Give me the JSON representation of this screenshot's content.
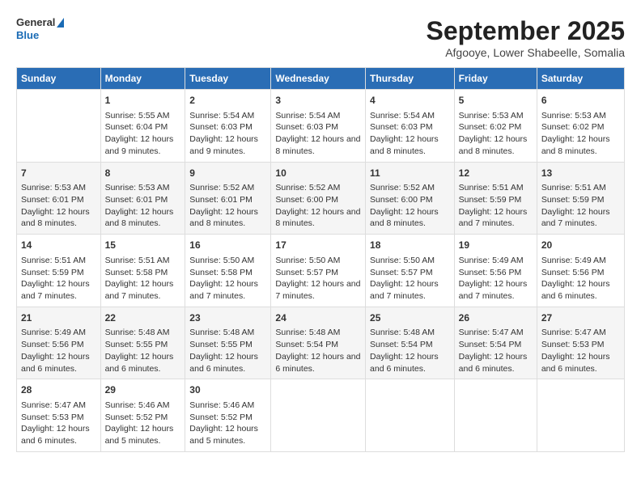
{
  "logo": {
    "line1": "General",
    "line2": "Blue"
  },
  "title": "September 2025",
  "subtitle": "Afgooye, Lower Shabeelle, Somalia",
  "days_of_week": [
    "Sunday",
    "Monday",
    "Tuesday",
    "Wednesday",
    "Thursday",
    "Friday",
    "Saturday"
  ],
  "weeks": [
    [
      {
        "day": "",
        "sunrise": "",
        "sunset": "",
        "daylight": ""
      },
      {
        "day": "1",
        "sunrise": "Sunrise: 5:55 AM",
        "sunset": "Sunset: 6:04 PM",
        "daylight": "Daylight: 12 hours and 9 minutes."
      },
      {
        "day": "2",
        "sunrise": "Sunrise: 5:54 AM",
        "sunset": "Sunset: 6:03 PM",
        "daylight": "Daylight: 12 hours and 9 minutes."
      },
      {
        "day": "3",
        "sunrise": "Sunrise: 5:54 AM",
        "sunset": "Sunset: 6:03 PM",
        "daylight": "Daylight: 12 hours and 8 minutes."
      },
      {
        "day": "4",
        "sunrise": "Sunrise: 5:54 AM",
        "sunset": "Sunset: 6:03 PM",
        "daylight": "Daylight: 12 hours and 8 minutes."
      },
      {
        "day": "5",
        "sunrise": "Sunrise: 5:53 AM",
        "sunset": "Sunset: 6:02 PM",
        "daylight": "Daylight: 12 hours and 8 minutes."
      },
      {
        "day": "6",
        "sunrise": "Sunrise: 5:53 AM",
        "sunset": "Sunset: 6:02 PM",
        "daylight": "Daylight: 12 hours and 8 minutes."
      }
    ],
    [
      {
        "day": "7",
        "sunrise": "Sunrise: 5:53 AM",
        "sunset": "Sunset: 6:01 PM",
        "daylight": "Daylight: 12 hours and 8 minutes."
      },
      {
        "day": "8",
        "sunrise": "Sunrise: 5:53 AM",
        "sunset": "Sunset: 6:01 PM",
        "daylight": "Daylight: 12 hours and 8 minutes."
      },
      {
        "day": "9",
        "sunrise": "Sunrise: 5:52 AM",
        "sunset": "Sunset: 6:01 PM",
        "daylight": "Daylight: 12 hours and 8 minutes."
      },
      {
        "day": "10",
        "sunrise": "Sunrise: 5:52 AM",
        "sunset": "Sunset: 6:00 PM",
        "daylight": "Daylight: 12 hours and 8 minutes."
      },
      {
        "day": "11",
        "sunrise": "Sunrise: 5:52 AM",
        "sunset": "Sunset: 6:00 PM",
        "daylight": "Daylight: 12 hours and 8 minutes."
      },
      {
        "day": "12",
        "sunrise": "Sunrise: 5:51 AM",
        "sunset": "Sunset: 5:59 PM",
        "daylight": "Daylight: 12 hours and 7 minutes."
      },
      {
        "day": "13",
        "sunrise": "Sunrise: 5:51 AM",
        "sunset": "Sunset: 5:59 PM",
        "daylight": "Daylight: 12 hours and 7 minutes."
      }
    ],
    [
      {
        "day": "14",
        "sunrise": "Sunrise: 5:51 AM",
        "sunset": "Sunset: 5:59 PM",
        "daylight": "Daylight: 12 hours and 7 minutes."
      },
      {
        "day": "15",
        "sunrise": "Sunrise: 5:51 AM",
        "sunset": "Sunset: 5:58 PM",
        "daylight": "Daylight: 12 hours and 7 minutes."
      },
      {
        "day": "16",
        "sunrise": "Sunrise: 5:50 AM",
        "sunset": "Sunset: 5:58 PM",
        "daylight": "Daylight: 12 hours and 7 minutes."
      },
      {
        "day": "17",
        "sunrise": "Sunrise: 5:50 AM",
        "sunset": "Sunset: 5:57 PM",
        "daylight": "Daylight: 12 hours and 7 minutes."
      },
      {
        "day": "18",
        "sunrise": "Sunrise: 5:50 AM",
        "sunset": "Sunset: 5:57 PM",
        "daylight": "Daylight: 12 hours and 7 minutes."
      },
      {
        "day": "19",
        "sunrise": "Sunrise: 5:49 AM",
        "sunset": "Sunset: 5:56 PM",
        "daylight": "Daylight: 12 hours and 7 minutes."
      },
      {
        "day": "20",
        "sunrise": "Sunrise: 5:49 AM",
        "sunset": "Sunset: 5:56 PM",
        "daylight": "Daylight: 12 hours and 6 minutes."
      }
    ],
    [
      {
        "day": "21",
        "sunrise": "Sunrise: 5:49 AM",
        "sunset": "Sunset: 5:56 PM",
        "daylight": "Daylight: 12 hours and 6 minutes."
      },
      {
        "day": "22",
        "sunrise": "Sunrise: 5:48 AM",
        "sunset": "Sunset: 5:55 PM",
        "daylight": "Daylight: 12 hours and 6 minutes."
      },
      {
        "day": "23",
        "sunrise": "Sunrise: 5:48 AM",
        "sunset": "Sunset: 5:55 PM",
        "daylight": "Daylight: 12 hours and 6 minutes."
      },
      {
        "day": "24",
        "sunrise": "Sunrise: 5:48 AM",
        "sunset": "Sunset: 5:54 PM",
        "daylight": "Daylight: 12 hours and 6 minutes."
      },
      {
        "day": "25",
        "sunrise": "Sunrise: 5:48 AM",
        "sunset": "Sunset: 5:54 PM",
        "daylight": "Daylight: 12 hours and 6 minutes."
      },
      {
        "day": "26",
        "sunrise": "Sunrise: 5:47 AM",
        "sunset": "Sunset: 5:54 PM",
        "daylight": "Daylight: 12 hours and 6 minutes."
      },
      {
        "day": "27",
        "sunrise": "Sunrise: 5:47 AM",
        "sunset": "Sunset: 5:53 PM",
        "daylight": "Daylight: 12 hours and 6 minutes."
      }
    ],
    [
      {
        "day": "28",
        "sunrise": "Sunrise: 5:47 AM",
        "sunset": "Sunset: 5:53 PM",
        "daylight": "Daylight: 12 hours and 6 minutes."
      },
      {
        "day": "29",
        "sunrise": "Sunrise: 5:46 AM",
        "sunset": "Sunset: 5:52 PM",
        "daylight": "Daylight: 12 hours and 5 minutes."
      },
      {
        "day": "30",
        "sunrise": "Sunrise: 5:46 AM",
        "sunset": "Sunset: 5:52 PM",
        "daylight": "Daylight: 12 hours and 5 minutes."
      },
      {
        "day": "",
        "sunrise": "",
        "sunset": "",
        "daylight": ""
      },
      {
        "day": "",
        "sunrise": "",
        "sunset": "",
        "daylight": ""
      },
      {
        "day": "",
        "sunrise": "",
        "sunset": "",
        "daylight": ""
      },
      {
        "day": "",
        "sunrise": "",
        "sunset": "",
        "daylight": ""
      }
    ]
  ]
}
